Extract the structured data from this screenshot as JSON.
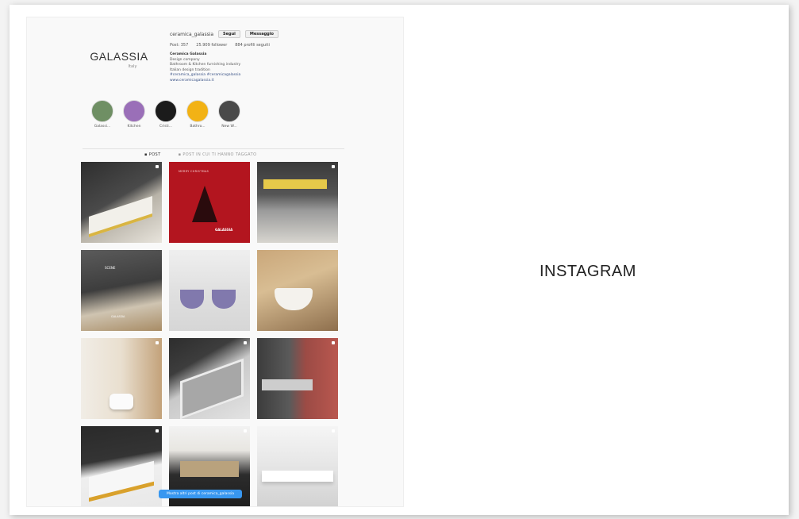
{
  "slide": {
    "label": "INSTAGRAM"
  },
  "profile": {
    "logo_text": "GALASSIA",
    "logo_sub": "Italy",
    "username": "ceramica_galassia",
    "follow_label": "Segui",
    "message_label": "Messaggio",
    "stats": [
      "Post: 357",
      "25.909 follower",
      "884 profili seguiti"
    ],
    "name": "Ceramica Galassia",
    "bio_lines": [
      "Design company",
      "Bathroom & Kitchen furnishing industry",
      "Italian design tradition",
      "#ceramica_galassia #ceramicagalassia"
    ],
    "website": "www.ceramicagalassia.it"
  },
  "highlights": [
    {
      "label": "Galassi...",
      "color": "#6f8f64"
    },
    {
      "label": "Kitchen",
      "color": "#9a6fb8"
    },
    {
      "label": "Cristi...",
      "color": "#1b1b1b"
    },
    {
      "label": "Bathro...",
      "color": "#f2b215"
    },
    {
      "label": "New W...",
      "color": "#4a4a4a"
    }
  ],
  "tabs": {
    "posts": "▪ POST",
    "tagged": "▪ POST IN CUI TI HANNO TAGGATO"
  },
  "grid_tiles": [
    {
      "name": "bathtub-post"
    },
    {
      "name": "christmas-post",
      "text_top": "MERRY CHRISTMAS",
      "text_bottom": "GALASSIA"
    },
    {
      "name": "vanity-post"
    },
    {
      "name": "shower-post",
      "text_top": "SCENE",
      "text_bottom": "GALASSIA"
    },
    {
      "name": "purple-basins-post"
    },
    {
      "name": "wall-basin-post"
    },
    {
      "name": "wc-post"
    },
    {
      "name": "long-basin-post"
    },
    {
      "name": "red-wall-post"
    },
    {
      "name": "yellow-bathtub-post"
    },
    {
      "name": "cabinet-post"
    },
    {
      "name": "double-basin-post"
    }
  ],
  "show_more": "Mostra altri post di ceramica_galassia"
}
